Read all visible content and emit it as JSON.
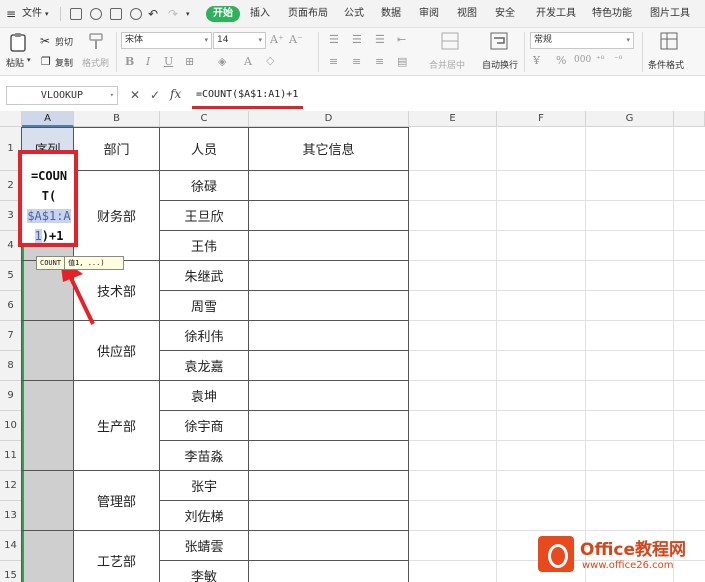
{
  "menu": {
    "file": "文件",
    "tabs": [
      "开始",
      "插入",
      "页面布局",
      "公式",
      "数据",
      "审阅",
      "视图",
      "安全",
      "开发工具",
      "特色功能",
      "图片工具"
    ],
    "active_tab": "开始"
  },
  "ribbon": {
    "paste": "粘贴",
    "cut": "剪切",
    "copy": "复制",
    "format_painter": "格式刷",
    "font_name": "宋体",
    "font_size": "14",
    "number_format": "常规",
    "merge_center": "合并居中",
    "wrap_text": "自动换行",
    "conditional_format": "条件格式"
  },
  "formula_bar": {
    "name_box": "VLOOKUP",
    "formula": "=COUNT($A$1:A1)+1"
  },
  "columns": [
    "A",
    "B",
    "C",
    "D",
    "E",
    "F",
    "G"
  ],
  "rows": [
    "1",
    "2",
    "3",
    "4",
    "5",
    "6",
    "7",
    "8",
    "9",
    "10",
    "11",
    "12",
    "13",
    "14",
    "15"
  ],
  "table": {
    "headers": [
      "序列",
      "部门",
      "人员",
      "其它信息"
    ],
    "departments": [
      "财务部",
      "技术部",
      "供应部",
      "生产部",
      "管理部",
      "工艺部"
    ],
    "people": [
      "徐碌",
      "王旦欣",
      "王伟",
      "朱继武",
      "周雪",
      "徐利伟",
      "袁龙嘉",
      "袁坤",
      "徐宇商",
      "李苗淼",
      "张宇",
      "刘佐梯",
      "张蜻雲",
      "李敏"
    ]
  },
  "edit_cell": {
    "line1": "=COUN",
    "line2": "T(",
    "line3": "$A$1:A",
    "line4_ref": "1",
    "line4_rest": ")+1"
  },
  "tooltip": {
    "function": "COUNT",
    "args": "值1, ...)"
  },
  "watermark": {
    "title": "Office教程网",
    "url": "www.office26.com"
  },
  "colors": {
    "accent_green": "#2fb25c",
    "highlight_red": "#e52228",
    "watermark_orange": "#d4461c"
  }
}
